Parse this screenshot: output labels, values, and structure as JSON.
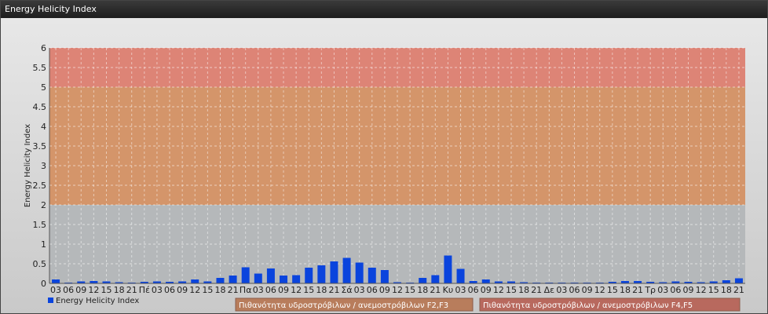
{
  "window": {
    "title": "Energy Helicity Index"
  },
  "chart_data": {
    "type": "bar",
    "ylabel": "Energy Helicity Index",
    "ylim": [
      0,
      6
    ],
    "yticks": [
      "0",
      "0.5",
      "1",
      "1.5",
      "2",
      "2.5",
      "3",
      "3.5",
      "4",
      "4.5",
      "5",
      "5.5",
      "6"
    ],
    "grid": true,
    "categories": [
      "03",
      "06",
      "09",
      "12",
      "15",
      "18",
      "21",
      "Πέ",
      "03",
      "06",
      "09",
      "12",
      "15",
      "18",
      "21",
      "Πα",
      "03",
      "06",
      "09",
      "12",
      "15",
      "18",
      "21",
      "Σά",
      "03",
      "06",
      "09",
      "12",
      "15",
      "18",
      "21",
      "Κυ",
      "03",
      "06",
      "09",
      "12",
      "15",
      "18",
      "21",
      "Δε",
      "03",
      "06",
      "09",
      "12",
      "15",
      "18",
      "21",
      "Τρ",
      "03",
      "06",
      "09",
      "12",
      "15",
      "18",
      "21"
    ],
    "series": [
      {
        "name": "Energy Helicity Index",
        "color": "#0a44dd",
        "values": [
          0.1,
          0.02,
          0.05,
          0.06,
          0.05,
          0.03,
          0.02,
          0.04,
          0.05,
          0.04,
          0.05,
          0.1,
          0.05,
          0.14,
          0.2,
          0.41,
          0.25,
          0.38,
          0.2,
          0.21,
          0.4,
          0.46,
          0.56,
          0.65,
          0.53,
          0.4,
          0.34,
          0.03,
          0.02,
          0.14,
          0.21,
          0.71,
          0.37,
          0.06,
          0.1,
          0.05,
          0.05,
          0.03,
          0.02,
          0.02,
          0.02,
          0.02,
          0.02,
          0.02,
          0.04,
          0.06,
          0.06,
          0.04,
          0.03,
          0.05,
          0.04,
          0.03,
          0.05,
          0.08,
          0.13,
          0.26
        ]
      }
    ],
    "bands": [
      {
        "from": 0,
        "to": 2,
        "color": "#b5b8ba"
      },
      {
        "from": 2,
        "to": 5,
        "color": "#d4956a"
      },
      {
        "from": 5,
        "to": 6,
        "color": "#dd8476"
      }
    ],
    "legend": {
      "position": "bottom-left"
    },
    "zones": [
      {
        "label": "Πιθανότητα υδροστρόβιλων / ανεμοστρόβιλων F2,F3",
        "color": "#b87d5c"
      },
      {
        "label": "Πιθανότητα υδροστρόβιλων / ανεμοστρόβιλων F4,F5",
        "color": "#b8695e"
      }
    ]
  }
}
